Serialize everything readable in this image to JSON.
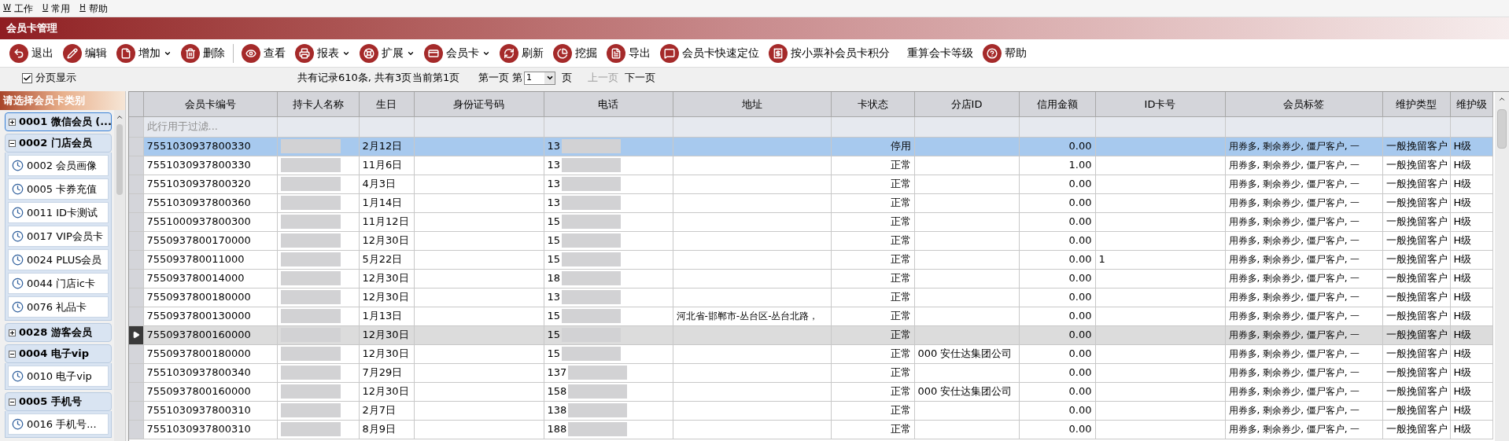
{
  "menu": [
    {
      "key": "W",
      "label": "工作"
    },
    {
      "key": "U",
      "label": "常用"
    },
    {
      "key": "H",
      "label": "帮助"
    }
  ],
  "window": {
    "title": "会员卡管理"
  },
  "toolbar": [
    {
      "kind": "icon",
      "label": "退出",
      "dropdown": false
    },
    {
      "kind": "icon",
      "label": "编辑",
      "dropdown": false
    },
    {
      "kind": "icon",
      "label": "增加",
      "dropdown": true
    },
    {
      "kind": "icon",
      "label": "删除",
      "dropdown": false
    },
    {
      "kind": "separator"
    },
    {
      "kind": "icon",
      "label": "查看",
      "dropdown": false
    },
    {
      "kind": "icon",
      "label": "报表",
      "dropdown": true
    },
    {
      "kind": "icon",
      "label": "扩展",
      "dropdown": true
    },
    {
      "kind": "icon",
      "label": "会员卡",
      "dropdown": true
    },
    {
      "kind": "icon",
      "label": "刷新",
      "dropdown": false
    },
    {
      "kind": "icon",
      "label": "挖掘",
      "dropdown": false
    },
    {
      "kind": "icon",
      "label": "导出",
      "dropdown": false
    },
    {
      "kind": "icon",
      "label": "会员卡快速定位",
      "dropdown": false
    },
    {
      "kind": "icon",
      "label": "按小票补会员卡积分",
      "dropdown": false
    },
    {
      "kind": "text",
      "label": "重算会卡等级",
      "dropdown": false
    },
    {
      "kind": "icon",
      "label": "帮助",
      "dropdown": false
    }
  ],
  "pager": {
    "paging": {
      "label": "分页显示",
      "checked": true
    },
    "records": "共有记录610条, 共有3页",
    "current": "当前第1页",
    "first": "第一页",
    "page_prefix": "第",
    "page_value": "1",
    "page_suffix": "页",
    "prev": {
      "label": "上一页",
      "disabled": true
    },
    "next": {
      "label": "下一页",
      "disabled": false
    }
  },
  "sidebar": {
    "title": "请选择会员卡类别",
    "groups": [
      {
        "label": "0001 微信会员 (...",
        "expanded": false,
        "selected": true
      },
      {
        "label": "0002 门店会员",
        "expanded": true,
        "selected": false,
        "children": [
          {
            "label": "0002 会员画像"
          },
          {
            "label": "0005 卡券充值"
          },
          {
            "label": "0011 ID卡测试"
          },
          {
            "label": "0017 VIP会员卡"
          },
          {
            "label": "0024 PLUS会员"
          },
          {
            "label": "0044 门店ic卡"
          },
          {
            "label": "0076 礼品卡"
          }
        ]
      },
      {
        "label": "0028 游客会员",
        "expanded": false,
        "selected": false
      },
      {
        "label": "0004 电子vip",
        "expanded": true,
        "selected": false,
        "children": [
          {
            "label": "0010 电子vip"
          }
        ]
      },
      {
        "label": "0005 手机号",
        "expanded": true,
        "selected": false,
        "children": [
          {
            "label": "0016 手机号..."
          }
        ]
      }
    ]
  },
  "table": {
    "columns": [
      "会员卡编号",
      "持卡人名称",
      "生日",
      "身份证号码",
      "电话",
      "地址",
      "卡状态",
      "分店ID",
      "信用金额",
      "ID卡号",
      "会员标签",
      "维护类型",
      "维护级"
    ],
    "filter_placeholder": "此行用于过滤...",
    "rows": [
      {
        "selected": true,
        "current": false,
        "cells": [
          "7551030937800330",
          "",
          "2月12日",
          "",
          "13",
          "",
          "停用",
          "",
          "0.00",
          "",
          "用券多, 剩余券少, 僵尸客户, 一",
          "一般挽留客户",
          "H级"
        ]
      },
      {
        "selected": false,
        "current": false,
        "cells": [
          "7551030937800330",
          "",
          "11月6日",
          "",
          "13",
          "",
          "正常",
          "",
          "1.00",
          "",
          "用券多, 剩余券少, 僵尸客户, 一",
          "一般挽留客户",
          "H级"
        ]
      },
      {
        "selected": false,
        "current": false,
        "cells": [
          "7551030937800320",
          "",
          "4月3日",
          "",
          "13",
          "",
          "正常",
          "",
          "0.00",
          "",
          "用券多, 剩余券少, 僵尸客户, 一",
          "一般挽留客户",
          "H级"
        ]
      },
      {
        "selected": false,
        "current": false,
        "cells": [
          "7551030937800360",
          "",
          "1月14日",
          "",
          "13",
          "",
          "正常",
          "",
          "0.00",
          "",
          "用券多, 剩余券少, 僵尸客户, 一",
          "一般挽留客户",
          "H级"
        ]
      },
      {
        "selected": false,
        "current": false,
        "cells": [
          "7551000937800300",
          "",
          "11月12日",
          "",
          "15",
          "",
          "正常",
          "",
          "0.00",
          "",
          "用券多, 剩余券少, 僵尸客户, 一",
          "一般挽留客户",
          "H级"
        ]
      },
      {
        "selected": false,
        "current": false,
        "cells": [
          "7550937800170000",
          "",
          "12月30日",
          "",
          "15",
          "",
          "正常",
          "",
          "0.00",
          "",
          "用券多, 剩余券少, 僵尸客户, 一",
          "一般挽留客户",
          "H级"
        ]
      },
      {
        "selected": false,
        "current": false,
        "cells": [
          "755093780011000",
          "",
          "5月22日",
          "",
          "15",
          "",
          "正常",
          "",
          "0.00",
          "1",
          "用券多, 剩余券少, 僵尸客户, 一",
          "一般挽留客户",
          "H级"
        ]
      },
      {
        "selected": false,
        "current": false,
        "cells": [
          "755093780014000",
          "",
          "12月30日",
          "",
          "18",
          "",
          "正常",
          "",
          "0.00",
          "",
          "用券多, 剩余券少, 僵尸客户, 一",
          "一般挽留客户",
          "H级"
        ]
      },
      {
        "selected": false,
        "current": false,
        "cells": [
          "7550937800180000",
          "",
          "12月30日",
          "",
          "13",
          "",
          "正常",
          "",
          "0.00",
          "",
          "用券多, 剩余券少, 僵尸客户, 一",
          "一般挽留客户",
          "H级"
        ]
      },
      {
        "selected": false,
        "current": false,
        "cells": [
          "7550937800130000",
          "",
          "1月13日",
          "",
          "15",
          "河北省-邯郸市-丛台区-丛台北路，",
          "正常",
          "",
          "0.00",
          "",
          "用券多, 剩余券少, 僵尸客户, 一",
          "一般挽留客户",
          "H级"
        ]
      },
      {
        "selected": false,
        "current": true,
        "cells": [
          "7550937800160000",
          "",
          "12月30日",
          "",
          "15",
          "",
          "正常",
          "",
          "0.00",
          "",
          "用券多, 剩余券少, 僵尸客户, 一",
          "一般挽留客户",
          "H级"
        ]
      },
      {
        "selected": false,
        "current": false,
        "cells": [
          "7550937800180000",
          "",
          "12月30日",
          "",
          "15",
          "",
          "正常",
          "000 安仕达集团公司",
          "0.00",
          "",
          "用券多, 剩余券少, 僵尸客户, 一",
          "一般挽留客户",
          "H级"
        ]
      },
      {
        "selected": false,
        "current": false,
        "cells": [
          "7551030937800340",
          "",
          "7月29日",
          "",
          "137",
          "",
          "正常",
          "",
          "0.00",
          "",
          "用券多, 剩余券少, 僵尸客户, 一",
          "一般挽留客户",
          "H级"
        ]
      },
      {
        "selected": false,
        "current": false,
        "cells": [
          "7550937800160000",
          "",
          "12月30日",
          "",
          "158",
          "",
          "正常",
          "000 安仕达集团公司",
          "0.00",
          "",
          "用券多, 剩余券少, 僵尸客户, 一",
          "一般挽留客户",
          "H级"
        ]
      },
      {
        "selected": false,
        "current": false,
        "cells": [
          "7551030937800310",
          "",
          "2月7日",
          "",
          "138",
          "",
          "正常",
          "",
          "0.00",
          "",
          "用券多, 剩余券少, 僵尸客户, 一",
          "一般挽留客户",
          "H级"
        ]
      },
      {
        "selected": false,
        "current": false,
        "cells": [
          "7551030937800310",
          "",
          "8月9日",
          "",
          "188",
          "",
          "正常",
          "",
          "0.00",
          "",
          "用券多, 剩余券少, 僵尸客户, 一",
          "一般挽留客户",
          "H级"
        ]
      }
    ]
  }
}
